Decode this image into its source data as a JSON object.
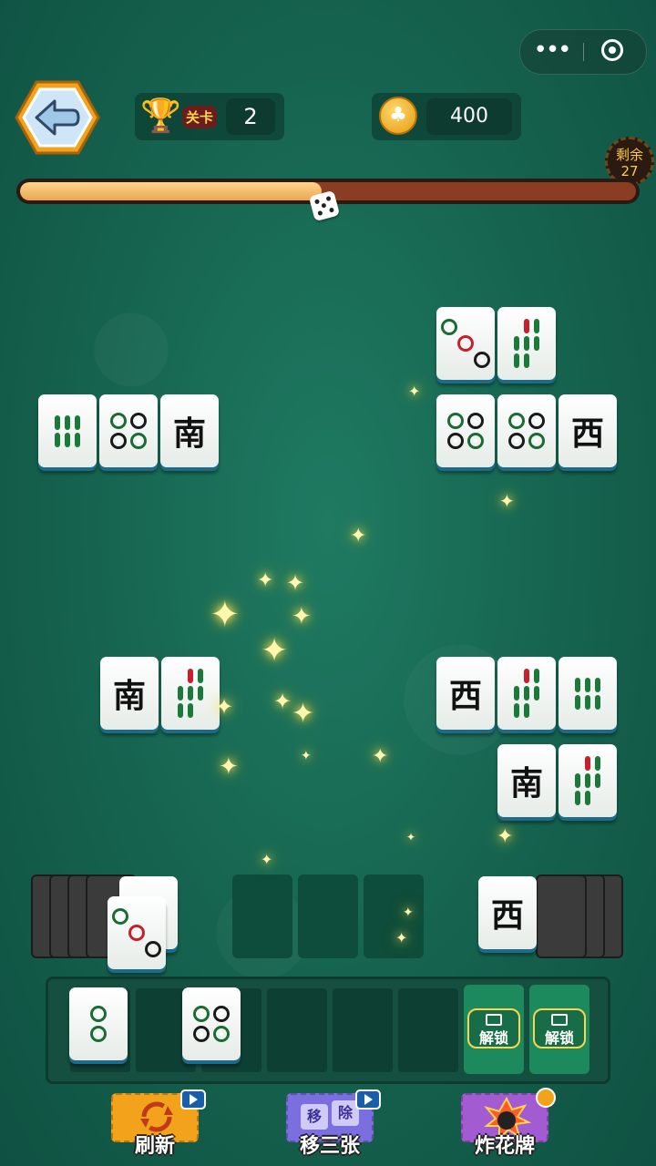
{
  "capsule": {
    "more_label": "•••"
  },
  "header": {
    "level_label": "关卡",
    "level_value": "2",
    "coins_value": "400",
    "coin_glyph": "♣"
  },
  "progress": {
    "fraction": 0.49,
    "remaining_label": "剩余",
    "remaining_value": "27"
  },
  "board": {
    "left_top_row": [
      "bamboo-8",
      "circle-4",
      "南"
    ],
    "right_top_upper": [
      "circle-3",
      "bamboo-7"
    ],
    "right_top_lower": [
      "circle-4",
      "circle-4",
      "西"
    ],
    "left_mid_row": [
      "南",
      "bamboo-7"
    ],
    "right_mid_upper": [
      "西",
      "bamboo-7",
      "bamboo-8"
    ],
    "right_mid_lower": [
      "南",
      "bamboo-7"
    ],
    "left_stack_top": [
      "circle-3"
    ],
    "right_stack_top": [
      "西"
    ]
  },
  "tray": {
    "tiles": [
      "circle-2",
      "",
      "circle-4",
      "",
      "",
      ""
    ],
    "unlock_label": "解锁"
  },
  "tools": {
    "refresh_label": "刷新",
    "remove_label": "移三张",
    "remove_badge_1": "移",
    "remove_badge_2": "除",
    "bomb_label": "炸花牌"
  },
  "colors": {
    "accent_gold": "#ffd44d",
    "felt": "#15624e",
    "tile_edge": "#1c6b8a"
  }
}
